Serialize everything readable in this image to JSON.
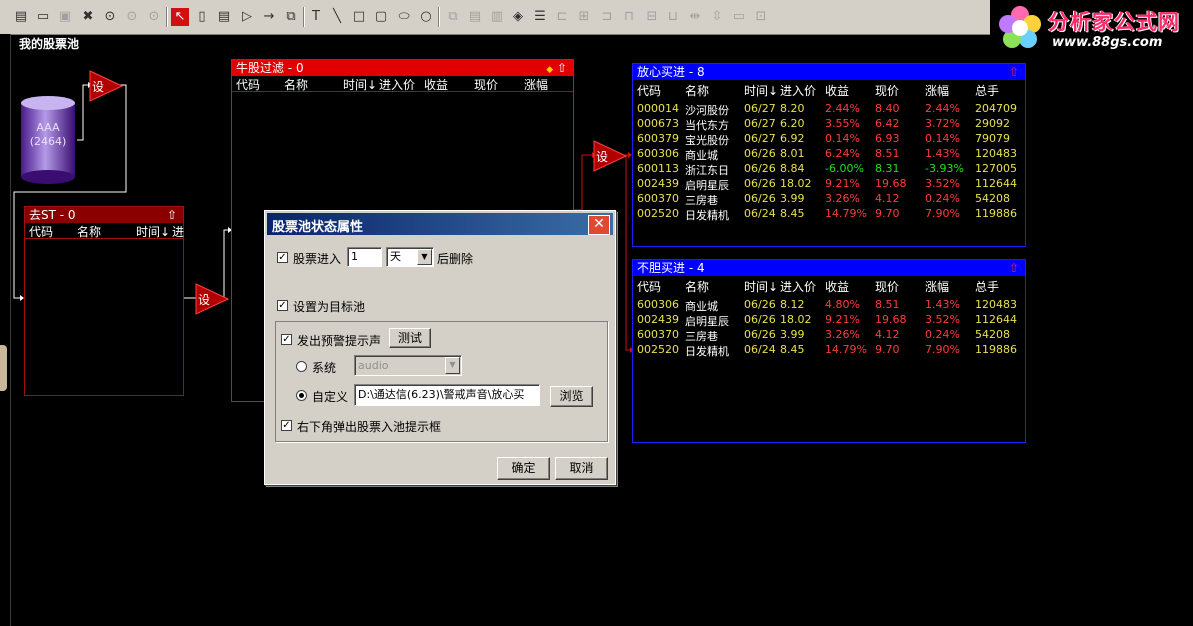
{
  "pool_title": "我的股票池",
  "logo": {
    "brand": "分析家公式网",
    "url": "www.88gs.com"
  },
  "toolbar_icons": [
    "new-page-icon",
    "open-folder-icon",
    "save-icon",
    "delete-icon",
    "play-icon",
    "pause-icon",
    "stop-icon",
    "pointer-icon",
    "database-icon",
    "document-icon",
    "flow-arrow-icon",
    "line-arrow-icon",
    "copy-icon",
    "text-icon",
    "line-icon",
    "rectangle-icon",
    "rounded-rect-icon",
    "ellipse-icon",
    "circle-icon",
    "copy-obj-icon",
    "paste-icon",
    "trash-icon",
    "fill-icon",
    "line-weight-icon",
    "align-left-icon",
    "align-center-icon",
    "align-right-icon",
    "align-top-icon",
    "align-middle-icon",
    "align-bottom-icon",
    "same-width-icon",
    "same-height-icon"
  ],
  "database": {
    "name": "AAA",
    "count": "(2464)"
  },
  "set_label": "设",
  "panels": {
    "filter": {
      "title": "牛股过滤 - 0",
      "columns": [
        "代码",
        "名称",
        "时间↓",
        "进入价",
        "收益",
        "现价",
        "涨幅"
      ],
      "rows": []
    },
    "remove_st": {
      "title": "去ST - 0",
      "columns": [
        "代码",
        "名称",
        "时间↓",
        "进"
      ],
      "rows": []
    },
    "safe_buy": {
      "title": "放心买进 - 8",
      "columns": [
        "代码",
        "名称",
        "时间↓",
        "进入价",
        "收益",
        "现价",
        "涨幅",
        "总手"
      ],
      "rows": [
        {
          "code": "000014",
          "name": "沙河股份",
          "time": "06/27",
          "entry": "8.20",
          "gain": "2.44%",
          "price": "8.40",
          "change": "2.44%",
          "volume": "204709"
        },
        {
          "code": "000673",
          "name": "当代东方",
          "time": "06/27",
          "entry": "6.20",
          "gain": "3.55%",
          "price": "6.42",
          "change": "3.72%",
          "volume": "29092"
        },
        {
          "code": "600379",
          "name": "宝光股份",
          "time": "06/27",
          "entry": "6.92",
          "gain": "0.14%",
          "price": "6.93",
          "change": "0.14%",
          "volume": "79079"
        },
        {
          "code": "600306",
          "name": "商业城",
          "time": "06/26",
          "entry": "8.01",
          "gain": "6.24%",
          "price": "8.51",
          "change": "1.43%",
          "volume": "120483"
        },
        {
          "code": "600113",
          "name": "浙江东日",
          "time": "06/26",
          "entry": "8.84",
          "gain": "-6.00%",
          "price": "8.31",
          "change": "-3.93%",
          "volume": "127005"
        },
        {
          "code": "002439",
          "name": "启明星辰",
          "time": "06/26",
          "entry": "18.02",
          "gain": "9.21%",
          "price": "19.68",
          "change": "3.52%",
          "volume": "112644"
        },
        {
          "code": "600370",
          "name": "三房巷",
          "time": "06/26",
          "entry": "3.99",
          "gain": "3.26%",
          "price": "4.12",
          "change": "0.24%",
          "volume": "54208"
        },
        {
          "code": "002520",
          "name": "日发精机",
          "time": "06/24",
          "entry": "8.45",
          "gain": "14.79%",
          "price": "9.70",
          "change": "7.90%",
          "volume": "119886"
        }
      ]
    },
    "bold_buy": {
      "title": "不胆买进 - 4",
      "columns": [
        "代码",
        "名称",
        "时间↓",
        "进入价",
        "收益",
        "现价",
        "涨幅",
        "总手"
      ],
      "rows": [
        {
          "code": "600306",
          "name": "商业城",
          "time": "06/26",
          "entry": "8.12",
          "gain": "4.80%",
          "price": "8.51",
          "change": "1.43%",
          "volume": "120483"
        },
        {
          "code": "002439",
          "name": "启明星辰",
          "time": "06/26",
          "entry": "18.02",
          "gain": "9.21%",
          "price": "19.68",
          "change": "3.52%",
          "volume": "112644"
        },
        {
          "code": "600370",
          "name": "三房巷",
          "time": "06/26",
          "entry": "3.99",
          "gain": "3.26%",
          "price": "4.12",
          "change": "0.24%",
          "volume": "54208"
        },
        {
          "code": "002520",
          "name": "日发精机",
          "time": "06/24",
          "entry": "8.45",
          "gain": "14.79%",
          "price": "9.70",
          "change": "7.90%",
          "volume": "119886"
        }
      ]
    }
  },
  "dialog": {
    "title": "股票池状态属性",
    "close_label": "✕",
    "enter_label": "股票进入",
    "enter_days_value": "1",
    "enter_unit_value": "天",
    "after_delete_label": "后删除",
    "set_target_label": "设置为目标池",
    "alert_sound_label": "发出预警提示声",
    "test_button": "测试",
    "system_label": "系统",
    "system_sound_value": "audio",
    "custom_label": "自定义",
    "custom_path_value": "D:\\通达信(6.23)\\警戒声音\\放心买",
    "browse_button": "浏览",
    "popup_label": "右下角弹出股票入池提示框",
    "ok_button": "确定",
    "cancel_button": "取消"
  }
}
